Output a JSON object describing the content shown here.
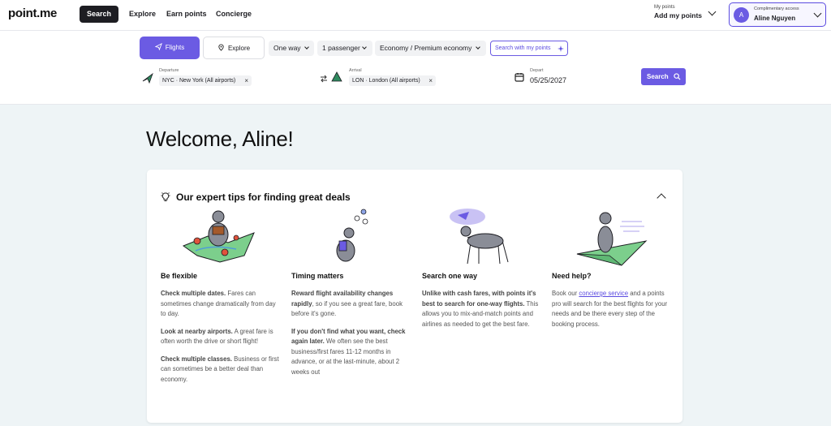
{
  "brand": {
    "logo": "point.me"
  },
  "nav": {
    "search": "Search",
    "explore": "Explore",
    "earn_points": "Earn points",
    "concierge": "Concierge"
  },
  "points": {
    "label": "My points",
    "action": "Add my points"
  },
  "user": {
    "access": "Complimentary access",
    "name": "Aline Nguyen",
    "initial": "A"
  },
  "search_tabs": {
    "flights": "Flights",
    "explore": "Explore"
  },
  "options": {
    "trip_type": "One way",
    "passengers": "1 passenger",
    "cabin": "Economy / Premium economy",
    "search_with_points": "Search with my points"
  },
  "departure": {
    "label": "Departure",
    "value": "NYC · New York (All airports)"
  },
  "arrival": {
    "label": "Arrival",
    "value": "LON · London (All airports)"
  },
  "depart": {
    "label": "Depart",
    "value": "05/25/2027"
  },
  "search_button": "Search",
  "welcome": "Welcome, Aline!",
  "tips": {
    "title": "Our expert tips for finding great deals",
    "be_flexible": {
      "heading": "Be flexible",
      "p1_bold": "Check multiple dates.",
      "p1_text": " Fares can sometimes change dramatically from day to day.",
      "p2_bold": "Look at nearby airports.",
      "p2_text": " A great fare is often worth the drive or short flight!",
      "p3_bold": "Check multiple classes.",
      "p3_text": " Business or first can sometimes be a better deal than economy."
    },
    "timing": {
      "heading": "Timing matters",
      "p1_bold": "Reward flight availability changes rapidly",
      "p1_text": ", so if you see a great fare, book before it's gone.",
      "p2_bold": "If you don't find what you want, check again later.",
      "p2_text": " We often see the best business/first fares 11-12 months in advance, or at the last-minute, about 2 weeks out"
    },
    "one_way": {
      "heading": "Search one way",
      "p1_bold": "Unlike with cash fares, with points it's best to search for one-way flights.",
      "p1_text": " This allows you to mix-and-match points and airlines as needed to get the best fare."
    },
    "help": {
      "heading": "Need help?",
      "p1_pre": "Book our ",
      "p1_link": "concierge service",
      "p1_post": " and a points pro will search for the best flights for your needs and be there every step of the booking process."
    }
  },
  "colors": {
    "accent": "#6b5be3",
    "dark": "#1d1d22",
    "page_bg": "#eef4f6"
  }
}
